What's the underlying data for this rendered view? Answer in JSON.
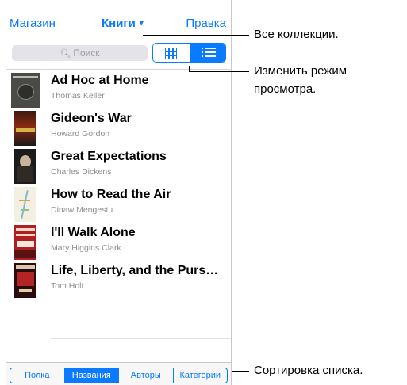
{
  "nav": {
    "left": "Магазин",
    "title": "Книги",
    "right": "Правка"
  },
  "search": {
    "placeholder": "Поиск"
  },
  "view_toggle": {
    "options": [
      "grid",
      "list"
    ],
    "selected": "list"
  },
  "books": [
    {
      "title": "Ad Hoc at Home",
      "author": "Thomas Keller"
    },
    {
      "title": "Gideon's War",
      "author": "Howard Gordon"
    },
    {
      "title": "Great Expectations",
      "author": "Charles Dickens"
    },
    {
      "title": "How to Read the Air",
      "author": "Dinaw Mengestu"
    },
    {
      "title": "I'll Walk Alone",
      "author": "Mary Higgins Clark"
    },
    {
      "title": "Life, Liberty, and the Purs…",
      "author": "Tom Holt"
    }
  ],
  "sort_tabs": {
    "items": [
      "Полка",
      "Названия",
      "Авторы",
      "Категории"
    ],
    "selected": "Названия"
  },
  "callouts": {
    "collections": "Все коллекции.",
    "view_mode_line1": "Изменить режим",
    "view_mode_line2": "просмотра.",
    "sort": "Сортировка списка."
  },
  "colors": {
    "accent": "#0a7aff",
    "secondary_text": "#8e8e93"
  }
}
